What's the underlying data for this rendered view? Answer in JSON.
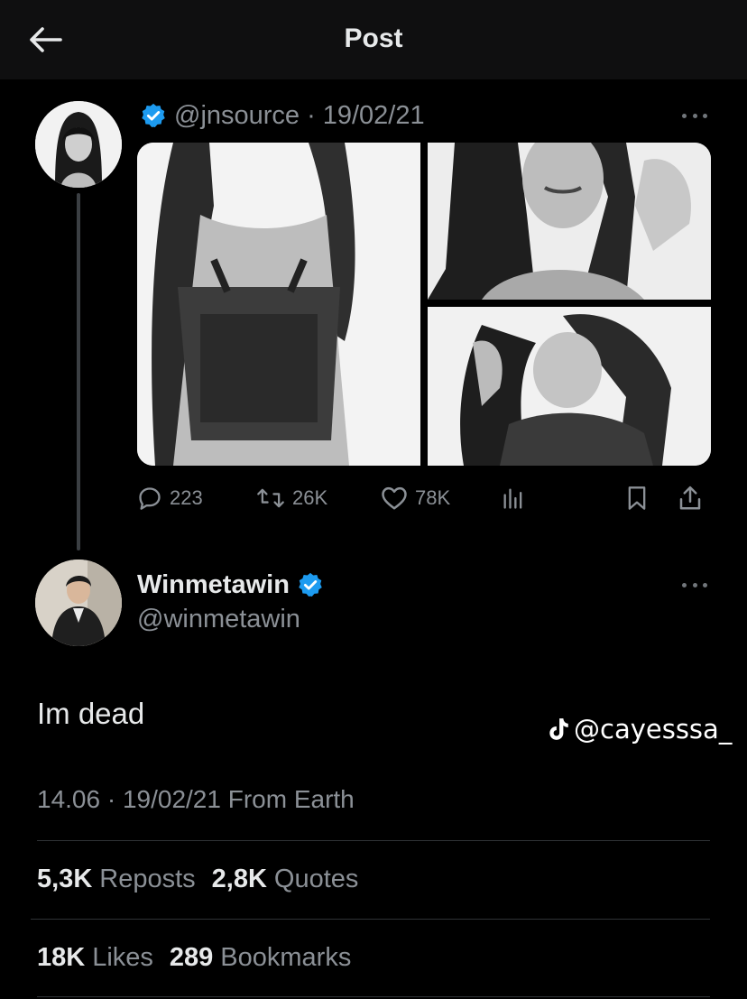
{
  "header": {
    "title": "Post",
    "back_icon": "arrow-left-icon"
  },
  "quoted_post": {
    "handle": "@jnsource",
    "separator": "·",
    "date": "19/02/21",
    "verified": true,
    "media_count": 3,
    "actions": {
      "replies": "223",
      "reposts": "26K",
      "likes": "78K"
    }
  },
  "post": {
    "display_name": "Winmetawin",
    "handle": "@winmetawin",
    "verified": true,
    "text": "Im dead",
    "timestamp": "14.06 · 19/02/21 From Earth",
    "stats": {
      "reposts_count": "5,3K",
      "reposts_label": "Reposts",
      "quotes_count": "2,8K",
      "quotes_label": "Quotes",
      "likes_count": "18K",
      "likes_label": "Likes",
      "bookmarks_count": "289",
      "bookmarks_label": "Bookmarks"
    }
  },
  "watermark": {
    "text": "@cayesssa_",
    "icon": "tiktok-icon"
  },
  "colors": {
    "background": "#000000",
    "text": "#e7e9ea",
    "muted": "#8b9096",
    "verified": "#1d9bf0"
  }
}
